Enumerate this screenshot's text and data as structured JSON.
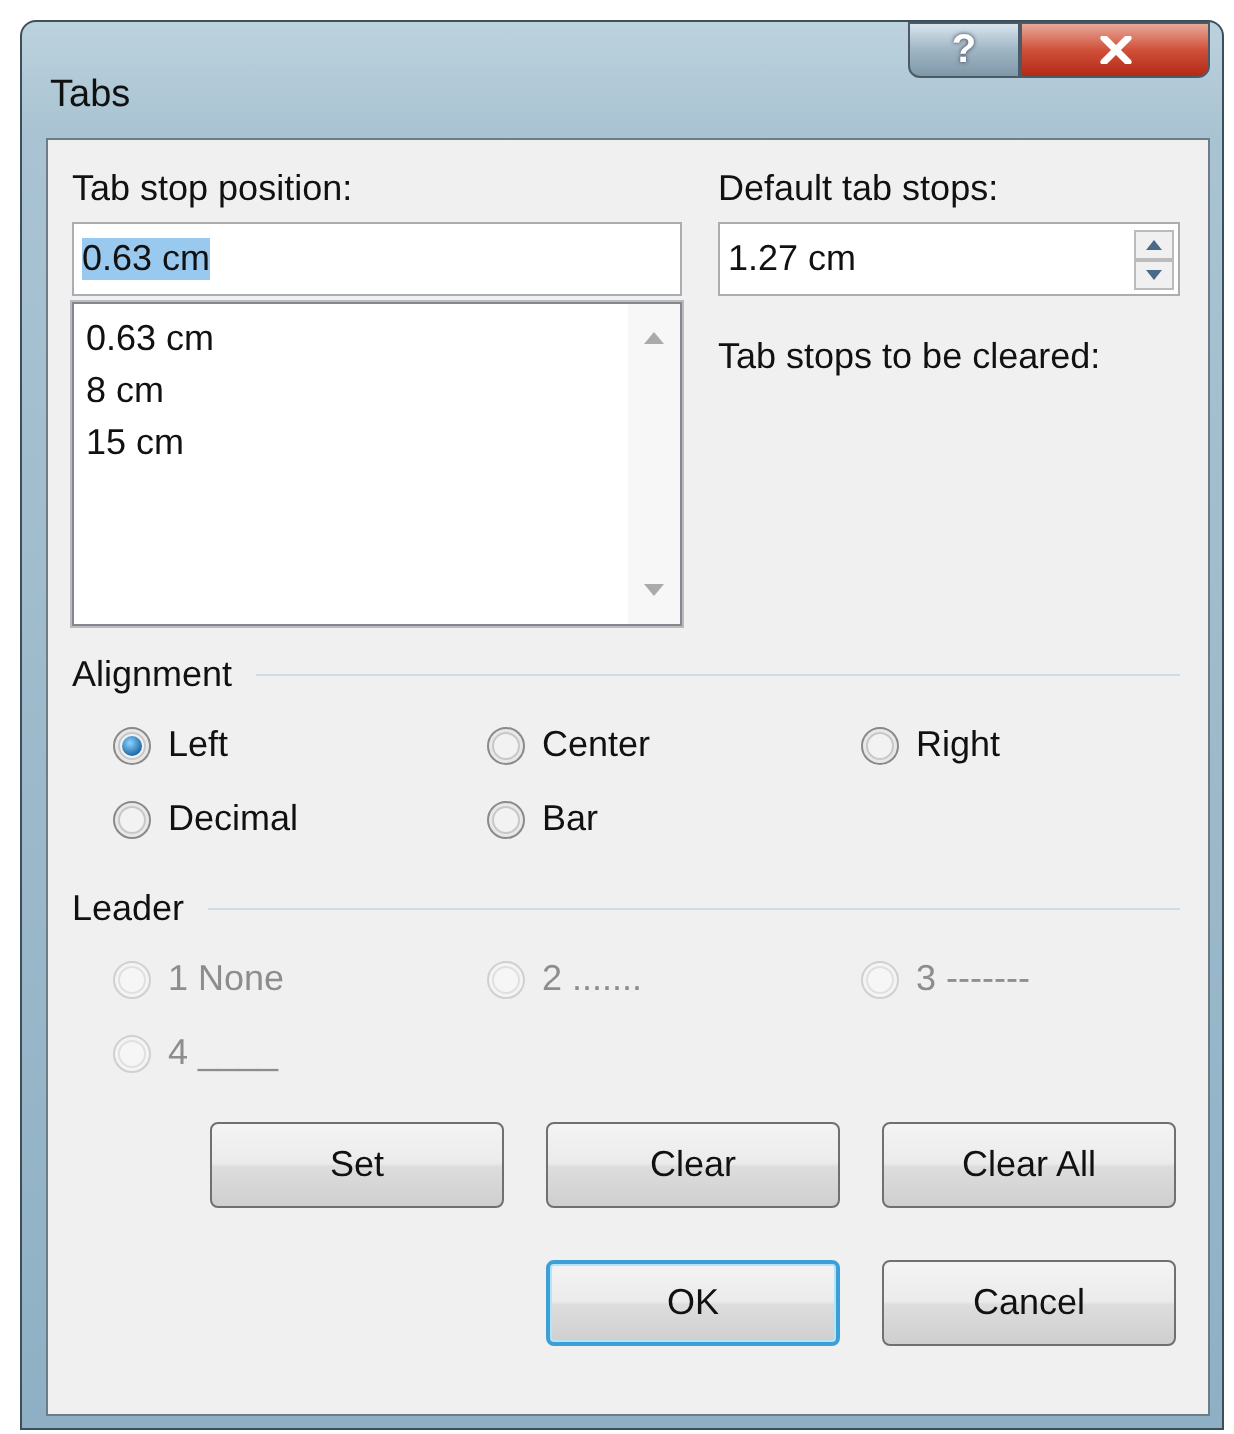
{
  "window": {
    "title": "Tabs"
  },
  "title_buttons": [
    {
      "kind": "help",
      "label": "?"
    },
    {
      "kind": "close"
    }
  ],
  "tab_stop_position": {
    "label": "Tab stop position:",
    "value": "0.63 cm",
    "text_selected": true
  },
  "tab_stop_list": {
    "items": [
      "0.63 cm",
      "8 cm",
      "15 cm"
    ]
  },
  "default_tab_stops": {
    "label": "Default tab stops:",
    "value": "1.27 cm"
  },
  "tab_stops_to_be_cleared": {
    "label": "Tab stops to be cleared:"
  },
  "alignment": {
    "label": "Alignment",
    "disabled": false,
    "options": [
      {
        "label": "Left",
        "selected": true
      },
      {
        "label": "Center",
        "selected": false
      },
      {
        "label": "Right",
        "selected": false
      },
      {
        "label": "Decimal",
        "selected": false
      },
      {
        "label": "Bar",
        "selected": false
      }
    ]
  },
  "leader": {
    "label": "Leader",
    "disabled": true,
    "options": [
      {
        "label": "1 None",
        "selected": false
      },
      {
        "label": "2 .......",
        "selected": false
      },
      {
        "label": "3 -------",
        "selected": false
      },
      {
        "label": "4 ____",
        "selected": false
      }
    ]
  },
  "action_buttons": [
    {
      "label": "Set",
      "default": false
    },
    {
      "label": "Clear",
      "default": false
    },
    {
      "label": "Clear All",
      "default": false
    }
  ],
  "dialog_buttons": [
    {
      "label": "OK",
      "default": true
    },
    {
      "label": "Cancel",
      "default": false
    }
  ]
}
